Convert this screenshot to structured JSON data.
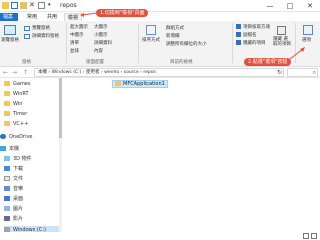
{
  "window": {
    "title": "repos",
    "minimize": "—",
    "maximize": "□",
    "close": "✕"
  },
  "ribbon_tabs": [
    "檔案",
    "常用",
    "共用",
    "檢視"
  ],
  "ribbon": {
    "pane_group": {
      "nav_pane": "瀏覽窗格",
      "preview_pane": "預覽窗格",
      "details_pane": "詳細資料窗格",
      "label": "窗格"
    },
    "layout_group": {
      "items": [
        "超大圖示",
        "大圖示",
        "中圖示",
        "小圖示",
        "清單",
        "詳細資料",
        "並排",
        "內容"
      ],
      "label": "版面配置"
    },
    "sort_by": "排序方式",
    "current_view_options": [
      "群組方式",
      "新增欄",
      "調整所有欄位的大小"
    ],
    "current_view_label": "目前的檢視",
    "show_hide": {
      "checkboxes": [
        {
          "label": "項目核取方塊",
          "checked": true
        },
        {
          "label": "副檔名",
          "checked": true
        },
        {
          "label": "隱藏的項目",
          "checked": true
        }
      ],
      "hide_selected": "隱藏 選取的項目",
      "label": "顯示/隱藏"
    },
    "options": "選項"
  },
  "callouts": {
    "one": "1.切換到\"檢視\"頁面",
    "two": "2.點選\"選項\"按鈕"
  },
  "address": {
    "back": "←",
    "forward": "→",
    "up": "↑",
    "path": [
      "本機",
      "Windows (C:)",
      "使用者",
      "wenho",
      "source",
      "repos"
    ],
    "refresh": "↻",
    "search_placeholder": "",
    "search_icon": "⌕"
  },
  "nav_pane": {
    "items": [
      {
        "label": "Games",
        "icon": "folder"
      },
      {
        "label": "WinRT",
        "icon": "folder"
      },
      {
        "label": "Win",
        "icon": "folder"
      },
      {
        "label": "Timer",
        "icon": "folder"
      },
      {
        "label": "VC++",
        "icon": "folder"
      },
      {
        "label": "OneDrive",
        "icon": "cloud"
      },
      {
        "label": "本機",
        "icon": "computer"
      },
      {
        "label": "3D 物件",
        "icon": "cube"
      },
      {
        "label": "下載",
        "icon": "download"
      },
      {
        "label": "文件",
        "icon": "document"
      },
      {
        "label": "音樂",
        "icon": "music"
      },
      {
        "label": "桌面",
        "icon": "desktop"
      },
      {
        "label": "圖片",
        "icon": "picture"
      },
      {
        "label": "影片",
        "icon": "video"
      },
      {
        "label": "Windows (C:)",
        "icon": "drive",
        "selected": true
      }
    ]
  },
  "content": {
    "files": [
      {
        "name": "MFCApplication1",
        "icon": "folder",
        "selected": true
      }
    ]
  },
  "colors": {
    "file_tab": "#1f6fd0",
    "callout": "#e64f3c",
    "selection": "#cce8ff",
    "folder": "#f2c94c"
  }
}
